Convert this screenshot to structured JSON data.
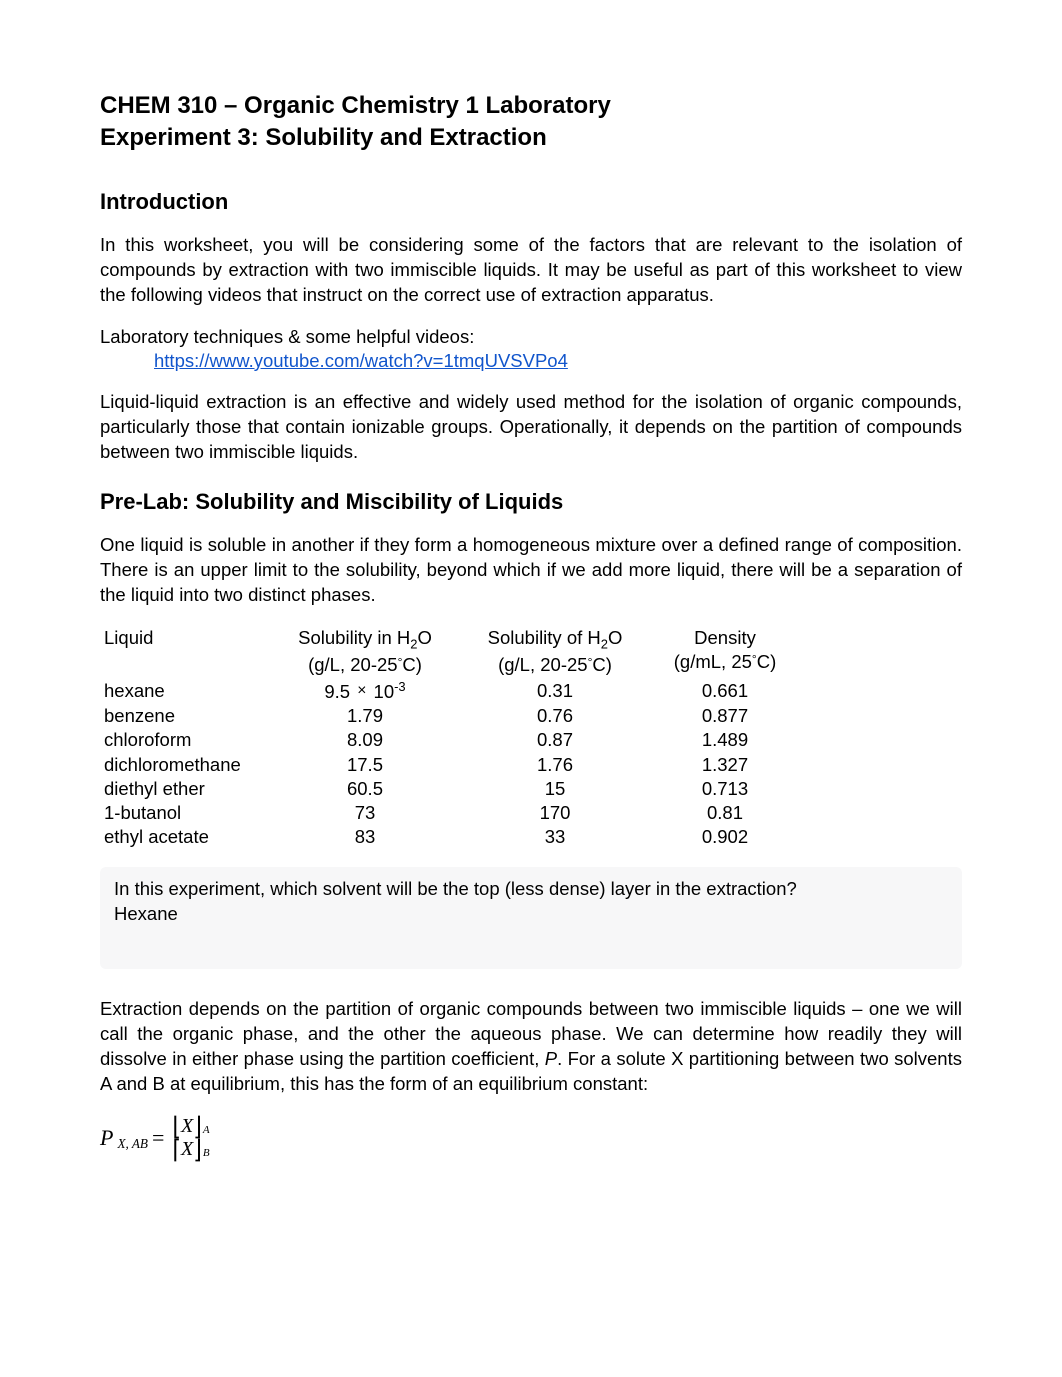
{
  "header": {
    "course": "CHEM 310 – Organic Chemistry 1 Laboratory",
    "experiment": "Experiment 3: Solubility and Extraction"
  },
  "intro": {
    "heading": "Introduction",
    "p1": "In this worksheet, you will be considering some of the factors that are relevant to the isolation of compounds by extraction with two immiscible liquids.  It may be useful as part of this worksheet to view the following videos that instruct on the correct use of extraction apparatus.",
    "videos_label": "Laboratory techniques & some helpful videos:",
    "video_link": "https://www.youtube.com/watch?v=1tmqUVSVPo4",
    "p2": "Liquid-liquid extraction is an effective and widely used method for the isolation of organic compounds, particularly those that contain ionizable groups.  Operationally, it depends on the partition of compounds between two immiscible liquids."
  },
  "prelab": {
    "heading": "Pre-Lab: Solubility and Miscibility of Liquids",
    "p1": "One liquid is soluble in another if they form a homogeneous mixture over a defined range of composition.  There is an upper limit to the solubility, beyond which if we add more liquid, there will be a separation of the liquid into two distinct phases.",
    "table": {
      "headers": {
        "liquid": "Liquid",
        "sol_in_h2o_l1": "Solubility in H",
        "sol_in_h2o_l2": "(g/L, 20-25",
        "sol_of_h2o_l1": "Solubility of H",
        "sol_of_h2o_l2": "(g/L, 20-25",
        "density_l1": "Density",
        "density_l2": "(g/mL, 25",
        "O": "O",
        "C_close": "C)"
      },
      "rows": [
        {
          "liquid": "hexane",
          "sol_in": "9.5",
          "sol_in_exp": "-3",
          "sol_of": "0.31",
          "density": "0.661"
        },
        {
          "liquid": "benzene",
          "sol_in": "1.79",
          "sol_of": "0.76",
          "density": "0.877"
        },
        {
          "liquid": "chloroform",
          "sol_in": "8.09",
          "sol_of": "0.87",
          "density": "1.489"
        },
        {
          "liquid": "dichloromethane",
          "sol_in": "17.5",
          "sol_of": "1.76",
          "density": "1.327"
        },
        {
          "liquid": "diethyl ether",
          "sol_in": "60.5",
          "sol_of": "15",
          "density": "0.713"
        },
        {
          "liquid": "1-butanol",
          "sol_in": "73",
          "sol_of": "170",
          "density": "0.81"
        },
        {
          "liquid": "ethyl acetate",
          "sol_in": "83",
          "sol_of": "33",
          "density": "0.902"
        }
      ]
    },
    "question": "In this experiment, which solvent will be the top (less dense) layer in the extraction?",
    "answer": "Hexane",
    "p2a": "Extraction depends on the partition of organic compounds between two immiscible liquids – one we will call the organic phase, and the other the aqueous phase.  We can determine how readily they will dissolve in either phase using the partition coefficient, ",
    "p2b": ".   For a solute X partitioning between two solvents A and B at equilibrium, this has the form of an equilibrium constant:",
    "P": "P",
    "formula": {
      "Psub": "X, AB",
      "eq": "=",
      "X": "X",
      "A": "A",
      "B": "B"
    }
  }
}
